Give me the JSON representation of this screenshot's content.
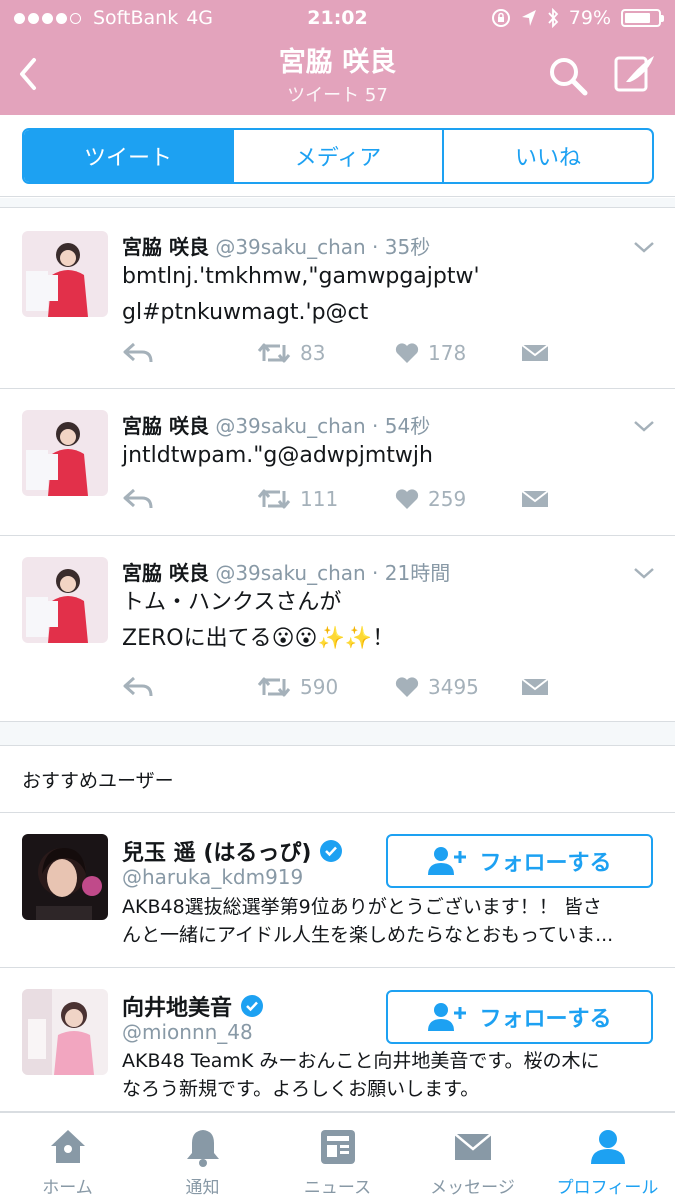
{
  "status": {
    "carrier": "SoftBank",
    "network": "4G",
    "time": "21:02",
    "battery": "79%",
    "battery_level": 0.79
  },
  "header": {
    "name": "宮脇 咲良",
    "subtitle": "ツイート 57"
  },
  "tabs": [
    {
      "label": "ツイート",
      "active": true
    },
    {
      "label": "メディア",
      "active": false
    },
    {
      "label": "いいね",
      "active": false
    }
  ],
  "tweets": [
    {
      "name": "宮脇 咲良",
      "handle": "@39saku_chan",
      "time": "35秒",
      "lines": [
        "bmtlnj.'tmkhmw,\"gamwpgajptw'",
        "gl#ptnkuwmagt.'p@ct"
      ],
      "retweets": "83",
      "likes": "178"
    },
    {
      "name": "宮脇 咲良",
      "handle": "@39saku_chan",
      "time": "54秒",
      "lines": [
        "jntldtwpam.\"g@adwpjmtwjh"
      ],
      "retweets": "111",
      "likes": "259"
    },
    {
      "name": "宮脇 咲良",
      "handle": "@39saku_chan",
      "time": "21時間",
      "lines": [
        "トム・ハンクスさんが",
        "ZEROに出てる😮😮✨✨！"
      ],
      "retweets": "590",
      "likes": "3495"
    }
  ],
  "recommend": {
    "title": "おすすめユーザー",
    "follow_label": "フォローする",
    "users": [
      {
        "name": "兒玉 遥 (はるっぴ)",
        "handle": "@haruka_kdm919",
        "bio_lines": [
          "AKB48選抜総選挙第9位ありがとうございます！！ 皆さ",
          "んと一緒にアイドル人生を楽しめたらなとおもっていま..."
        ]
      },
      {
        "name": "向井地美音",
        "handle": "@mionnn_48",
        "bio_lines": [
          "AKB48 TeamK みーおんこと向井地美音です。桜の木に",
          "なろう新規です。よろしくお願いします。"
        ]
      }
    ]
  },
  "tabbar": [
    {
      "label": "ホーム",
      "icon": "home-icon",
      "active": false
    },
    {
      "label": "通知",
      "icon": "bell-icon",
      "active": false
    },
    {
      "label": "ニュース",
      "icon": "news-icon",
      "active": false
    },
    {
      "label": "メッセージ",
      "icon": "envelope-icon",
      "active": false
    },
    {
      "label": "プロフィール",
      "icon": "person-icon",
      "active": true
    }
  ],
  "colors": {
    "header": "#e3a3bc",
    "accent": "#1da1f2",
    "muted": "#8899a6"
  }
}
